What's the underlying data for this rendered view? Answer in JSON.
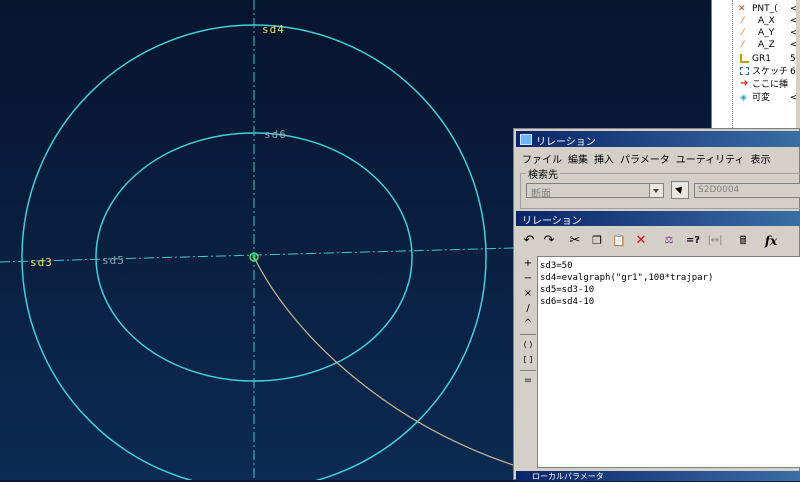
{
  "canvas": {
    "dimensions": [
      "sd4",
      "sd6",
      "sd3",
      "sd5"
    ],
    "colors": {
      "circle": "#3fd0d8",
      "centerline": "#40c8c8",
      "trajectory": "#c8b890",
      "label_yellow": "#e8e060",
      "label_gray": "#8aa0b0"
    }
  },
  "tree": {
    "items": [
      {
        "label": "PNT_(",
        "value": "<な"
      },
      {
        "label": "A_X",
        "value": "<な"
      },
      {
        "label": "A_Y",
        "value": "<な"
      },
      {
        "label": "A_Z",
        "value": "<な"
      },
      {
        "label": "GR1",
        "value": "5"
      },
      {
        "label": "スケッチ",
        "value": "6"
      },
      {
        "label": "ここに挿",
        "value": ""
      },
      {
        "label": "可変",
        "value": "<な"
      }
    ]
  },
  "relation_window": {
    "title": "リレーション",
    "menu": [
      "ファイル",
      "編集",
      "挿入",
      "パラメータ",
      "ユーティリティ",
      "表示"
    ],
    "search_group_label": "検索先",
    "search_type_value": "断面",
    "search_id_value": "S2D0004",
    "section_title": "リレーション",
    "sidebar_ops": [
      "+",
      "−",
      "×",
      "/",
      "^",
      "( )",
      "[ ]",
      "="
    ],
    "relations": [
      "sd3=50",
      "sd4=evalgraph(\"gr1\",100*trajpar)",
      "sd5=sd3-10",
      "sd6=sd4-10"
    ],
    "bottom_title": "ローカルパラメータ"
  }
}
